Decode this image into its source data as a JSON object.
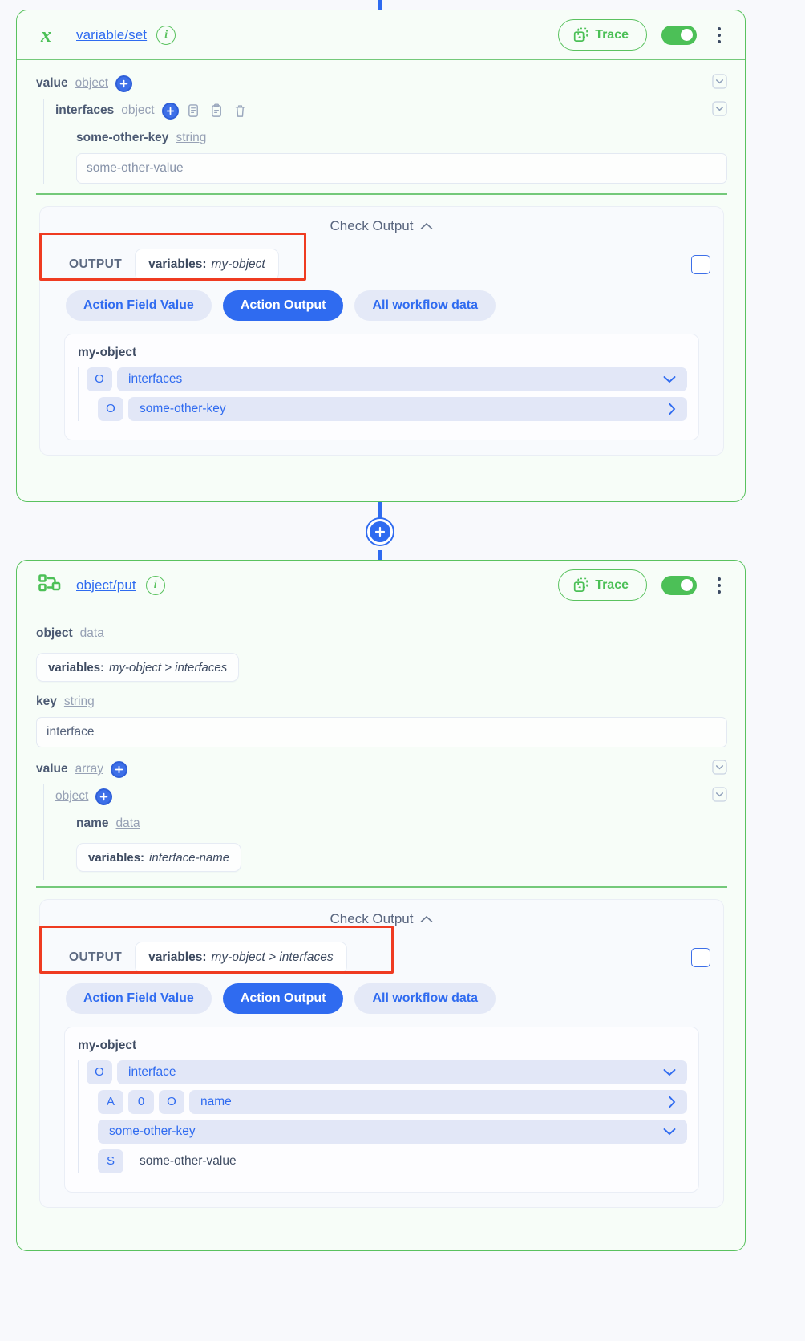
{
  "connector": {
    "add_node_icon": "plus-icon"
  },
  "cards": [
    {
      "id": "variable-set",
      "node_icon": "variable-x-icon",
      "title": "variable/set",
      "info_icon": "info-icon",
      "trace_label": "Trace",
      "trace_icon": "copy-dashed-icon",
      "toggle_state": "on",
      "menu_icon": "kebab-menu-icon",
      "fields": {
        "value_label": "value",
        "value_type": "object",
        "interfaces_label": "interfaces",
        "interfaces_type": "object",
        "key_label": "some-other-key",
        "key_type": "string",
        "value_input": "some-other-value",
        "copy_icon": "copy-icon",
        "paste_icon": "paste-icon",
        "delete_icon": "trash-icon"
      },
      "check_output": {
        "title": "Check Output",
        "collapse_icon": "chevron-up-icon",
        "output_label": "OUTPUT",
        "chip_prefix": "variables:",
        "chip_value": "my-object",
        "checkbox_checked": false,
        "tabs": [
          {
            "label": "Action Field Value",
            "active": false
          },
          {
            "label": "Action Output",
            "active": true
          },
          {
            "label": "All workflow data",
            "active": false
          }
        ],
        "tree_root": "my-object",
        "tree": [
          {
            "badges": [
              "O"
            ],
            "label": "interfaces",
            "caret": "chevron-down-icon",
            "depth": 0
          },
          {
            "badges": [
              "O"
            ],
            "label": "some-other-key",
            "caret": "chevron-right-icon",
            "depth": 1
          }
        ]
      }
    },
    {
      "id": "object-put",
      "node_icon": "object-nodes-icon",
      "title": "object/put",
      "info_icon": "info-icon",
      "trace_label": "Trace",
      "trace_icon": "copy-dashed-icon",
      "toggle_state": "on",
      "menu_icon": "kebab-menu-icon",
      "fields": {
        "object_label": "object",
        "object_type": "data",
        "object_chip_prefix": "variables:",
        "object_chip_value": "my-object > interfaces",
        "key_label": "key",
        "key_type": "string",
        "key_input": "interface",
        "value_label": "value",
        "value_type": "array",
        "nested_object_type": "object",
        "name_label": "name",
        "name_type": "data",
        "name_chip_prefix": "variables:",
        "name_chip_value": "interface-name"
      },
      "check_output": {
        "title": "Check Output",
        "collapse_icon": "chevron-up-icon",
        "output_label": "OUTPUT",
        "chip_prefix": "variables:",
        "chip_value": "my-object > interfaces",
        "checkbox_checked": false,
        "tabs": [
          {
            "label": "Action Field Value",
            "active": false
          },
          {
            "label": "Action Output",
            "active": true
          },
          {
            "label": "All workflow data",
            "active": false
          }
        ],
        "tree_root": "my-object",
        "tree": [
          {
            "badges": [
              "O"
            ],
            "label": "interface",
            "caret": "chevron-down-icon",
            "depth": 0
          },
          {
            "badges": [
              "A",
              "0",
              "O"
            ],
            "label": "name",
            "caret": "chevron-right-icon",
            "depth": 1
          },
          {
            "badges": [],
            "label": "some-other-key",
            "caret": "chevron-down-icon",
            "depth": 1
          },
          {
            "badges": [
              "S"
            ],
            "label": "some-other-value",
            "caret": "",
            "depth": 1,
            "plain": true
          }
        ]
      }
    }
  ],
  "colors": {
    "card_border_green": "#5ac25f",
    "card_bg_green": "#f7fdf8",
    "accent_blue": "#2f6bf0",
    "annotation_red": "#ef3b21",
    "badge_bg": "#e2e7f7"
  }
}
